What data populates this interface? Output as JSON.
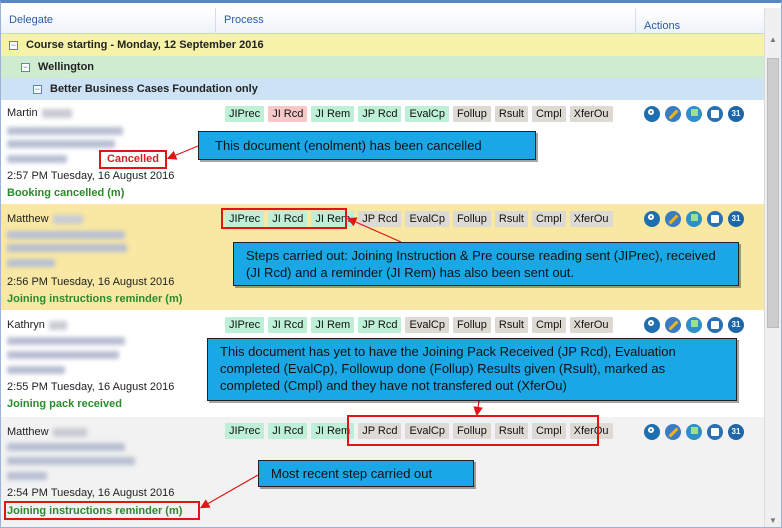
{
  "header": {
    "delegate": "Delegate",
    "process": "Process",
    "actions": "Actions"
  },
  "groups": {
    "course": "Course starting - Monday, 12 September 2016",
    "location": "Wellington",
    "course_name": "Better Business Cases Foundation only"
  },
  "rows": [
    {
      "name": "Martin",
      "timestamp": "2:57 PM Tuesday, 16 August 2016",
      "status": "Booking cancelled (m)",
      "badge": "Cancelled",
      "steps": [
        "JIPrec",
        "JI Rcd",
        "JI Rem",
        "JP Rcd",
        "EvalCp",
        "Follup",
        "Rsult",
        "Cmpl",
        "XferOu"
      ],
      "step_states": [
        "done",
        "warn",
        "done",
        "done",
        "done",
        "pending",
        "pending",
        "pending",
        "pending"
      ]
    },
    {
      "name": "Matthew",
      "timestamp": "2:56 PM Tuesday, 16 August 2016",
      "status": "Joining instructions reminder (m)",
      "steps": [
        "JIPrec",
        "JI Rcd",
        "JI Rem",
        "JP Rcd",
        "EvalCp",
        "Follup",
        "Rsult",
        "Cmpl",
        "XferOu"
      ],
      "step_states": [
        "done",
        "done",
        "done",
        "pending",
        "pending",
        "pending",
        "pending",
        "pending",
        "pending"
      ]
    },
    {
      "name": "Kathryn",
      "timestamp": "2:55 PM Tuesday, 16 August 2016",
      "status": "Joining pack received",
      "steps": [
        "JIPrec",
        "JI Rcd",
        "JI Rem",
        "JP Rcd",
        "EvalCp",
        "Follup",
        "Rsult",
        "Cmpl",
        "XferOu"
      ],
      "step_states": [
        "done",
        "done",
        "done",
        "done",
        "pending",
        "pending",
        "pending",
        "pending",
        "pending"
      ]
    },
    {
      "name": "Matthew",
      "timestamp": "2:54 PM Tuesday, 16 August 2016",
      "status": "Joining instructions reminder (m)",
      "steps": [
        "JIPrec",
        "JI Rcd",
        "JI Rem",
        "JP Rcd",
        "EvalCp",
        "Follup",
        "Rsult",
        "Cmpl",
        "XferOu"
      ],
      "step_states": [
        "done",
        "done",
        "done",
        "pending",
        "pending",
        "pending",
        "pending",
        "pending",
        "pending"
      ]
    }
  ],
  "actions": {
    "cal_label": "31"
  },
  "callouts": {
    "cancelled": "This document (enolment) has been cancelled",
    "steps": "Steps carried out: Joining Instruction & Pre course reading sent (JIPrec), received (JI Rcd) and a reminder (JI Rem) has also been sent out.",
    "pending": "This document has yet to have the Joining Pack Received (JP Rcd), Evaluation completed (EvalCp), Followup done (Follup) Results given (Rsult), marked as completed (Cmpl) and they have not transfered out (XferOu)",
    "recent": "Most recent step carried out"
  },
  "colors": {
    "step_done": "#bdf0d6",
    "step_warn": "#f7c8c8",
    "step_pending": "#ddd9d3",
    "highlight": "#e01515",
    "callout": "#1aa7e6",
    "status": "#2b8a2b"
  }
}
